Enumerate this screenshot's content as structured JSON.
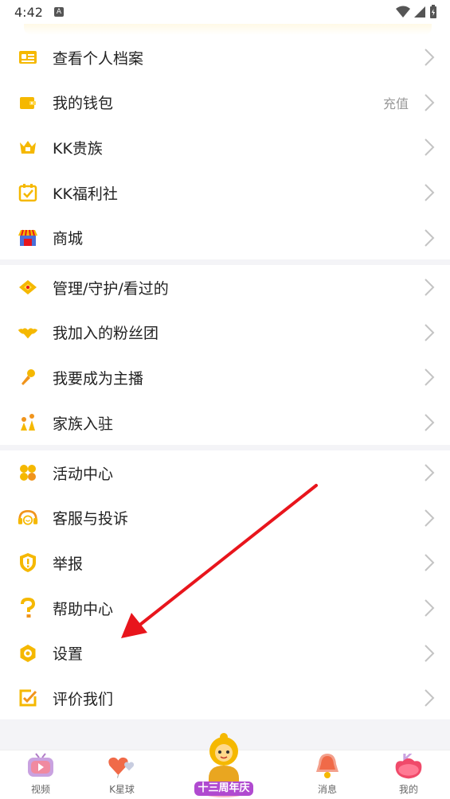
{
  "status_bar": {
    "time": "4:42",
    "notification_badge": "A"
  },
  "groups": [
    {
      "items": [
        {
          "name": "profile",
          "label": "查看个人档案",
          "icon": "id-card-icon"
        },
        {
          "name": "wallet",
          "label": "我的钱包",
          "extra": "充值",
          "icon": "wallet-icon"
        },
        {
          "name": "nobility",
          "label": "KK贵族",
          "icon": "crown-icon"
        },
        {
          "name": "welfare",
          "label": "KK福利社",
          "icon": "calendar-check-icon"
        },
        {
          "name": "shop",
          "label": "商城",
          "icon": "store-icon"
        }
      ]
    },
    {
      "items": [
        {
          "name": "manage",
          "label": "管理/守护/看过的",
          "icon": "diamond-icon"
        },
        {
          "name": "fan-club",
          "label": "我加入的粉丝团",
          "icon": "heart-wings-icon"
        },
        {
          "name": "become-host",
          "label": "我要成为主播",
          "icon": "microphone-icon"
        },
        {
          "name": "family",
          "label": "家族入驻",
          "icon": "family-icon"
        }
      ]
    },
    {
      "items": [
        {
          "name": "activity",
          "label": "活动中心",
          "icon": "clover-icon"
        },
        {
          "name": "service",
          "label": "客服与投诉",
          "icon": "headset-icon"
        },
        {
          "name": "report",
          "label": "举报",
          "icon": "shield-alert-icon"
        },
        {
          "name": "help",
          "label": "帮助中心",
          "icon": "question-icon"
        },
        {
          "name": "settings",
          "label": "设置",
          "icon": "gear-icon"
        },
        {
          "name": "rate",
          "label": "评价我们",
          "icon": "edit-check-icon"
        }
      ]
    }
  ],
  "tabbar": {
    "tabs": [
      {
        "name": "video",
        "label": "视频",
        "icon": "tv-icon"
      },
      {
        "name": "planet",
        "label": "K星球",
        "icon": "heart-balloon-icon"
      },
      {
        "name": "anniversary",
        "label": "",
        "icon": "anniversary-mascot-icon",
        "badge_text": "十三周年庆"
      },
      {
        "name": "messages",
        "label": "消息",
        "icon": "bell-icon"
      },
      {
        "name": "mine",
        "label": "我的",
        "icon": "k-avatar-icon"
      }
    ]
  },
  "colors": {
    "accent": "#f5b800",
    "arrow": "#e8151c",
    "separator": "#f4f4f7",
    "chevron": "#c4c4c4"
  }
}
